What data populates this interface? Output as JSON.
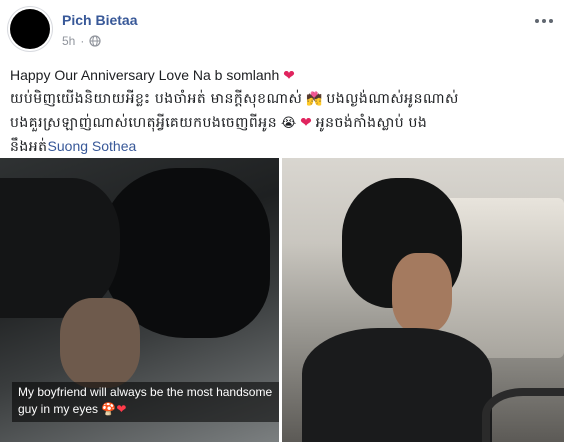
{
  "post": {
    "author": "Pich Bietaa",
    "time": "5h",
    "privacy_icon": "globe-icon",
    "line1": "Happy Our Anniversary Love Na b somlanh",
    "line2_khmer": "យប់មិញយើងនិយាយអីខ្លះ បងចាំអត់ មានក្តីសុខណាស់",
    "line2_end_khmer": "បងល្ងង់ណាស់អូនណាស់",
    "line3_khmer": "បងគួរស្រឡាញ់ណាស់ហេតុអ្វីគេយកបងចេញពីអូន",
    "line3_end_khmer": "អូនចង់កាំងស្លាប់ បង",
    "line4_khmer": "នឹងអត់",
    "mention": "Suong Sothea",
    "heart": "❤",
    "emoji_kiss": "💏",
    "emoji_cry": "😭"
  },
  "photos": {
    "left_caption_line1": "My boyfriend will always be the most handsome",
    "left_caption_line2": "guy in my eyes",
    "caption_emoji": "🍄❤"
  },
  "colors": {
    "link": "#385898",
    "meta": "#90949c",
    "heart": "#e0245e"
  }
}
